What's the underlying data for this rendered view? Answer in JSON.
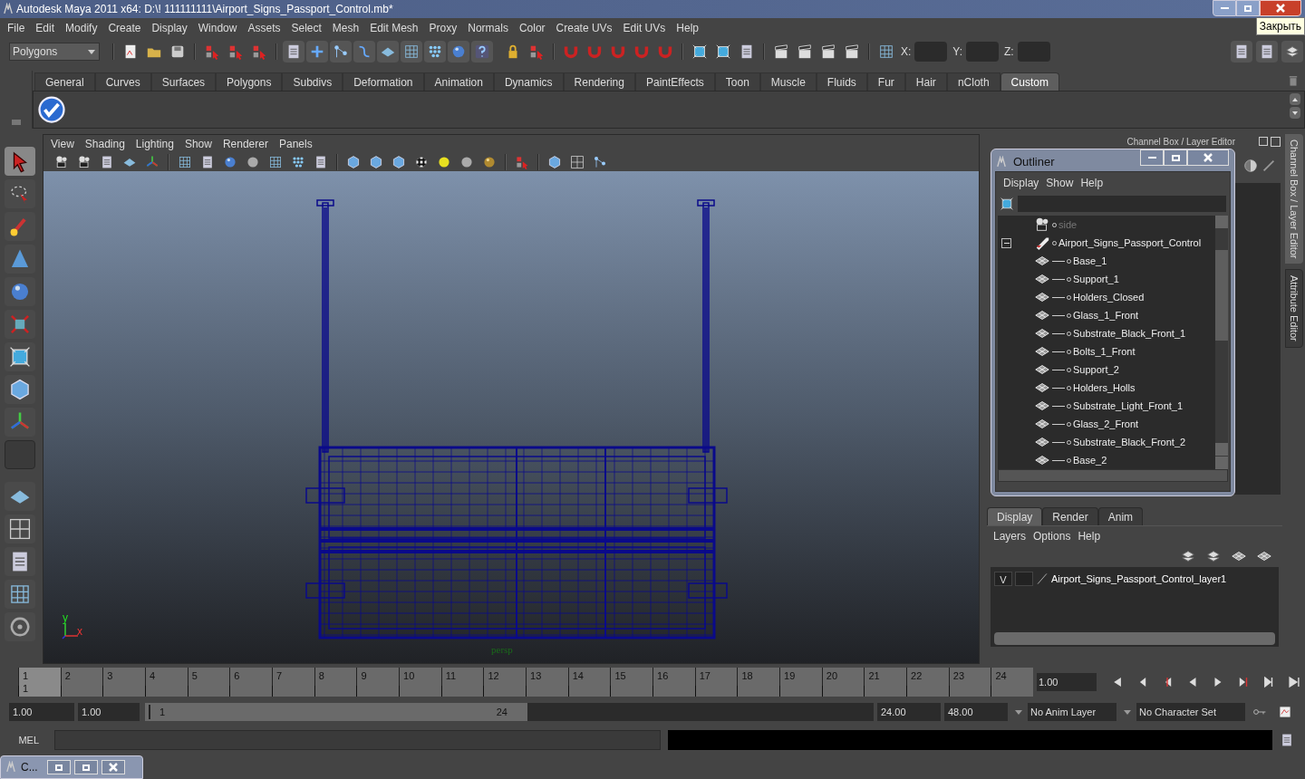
{
  "window": {
    "title": "Autodesk Maya 2011 x64: D:\\! 111111111\\Airport_Signs_Passport_Control.mb*",
    "tooltip": "Закрыть"
  },
  "menu_bar": [
    "File",
    "Edit",
    "Modify",
    "Create",
    "Display",
    "Window",
    "Assets",
    "Select",
    "Mesh",
    "Edit Mesh",
    "Proxy",
    "Normals",
    "Color",
    "Create UVs",
    "Edit UVs",
    "Help"
  ],
  "status_line": {
    "mode": "Polygons",
    "fields": [
      {
        "label": "X:"
      },
      {
        "label": "Y:"
      },
      {
        "label": "Z:"
      }
    ]
  },
  "shelf": {
    "tabs": [
      {
        "label": "General",
        "selected": false
      },
      {
        "label": "Curves",
        "selected": false
      },
      {
        "label": "Surfaces",
        "selected": false
      },
      {
        "label": "Polygons",
        "selected": false
      },
      {
        "label": "Subdivs",
        "selected": false
      },
      {
        "label": "Deformation",
        "selected": false
      },
      {
        "label": "Animation",
        "selected": false
      },
      {
        "label": "Dynamics",
        "selected": false
      },
      {
        "label": "Rendering",
        "selected": false
      },
      {
        "label": "PaintEffects",
        "selected": false
      },
      {
        "label": "Toon",
        "selected": false
      },
      {
        "label": "Muscle",
        "selected": false
      },
      {
        "label": "Fluids",
        "selected": false
      },
      {
        "label": "Fur",
        "selected": false
      },
      {
        "label": "Hair",
        "selected": false
      },
      {
        "label": "nCloth",
        "selected": false
      },
      {
        "label": "Custom",
        "selected": true
      }
    ]
  },
  "viewport": {
    "menu": [
      "View",
      "Shading",
      "Lighting",
      "Show",
      "Renderer",
      "Panels"
    ],
    "axis_y": "y",
    "axis_x": "x",
    "camera": "persp"
  },
  "channel_box": {
    "title": "Channel Box / Layer Editor"
  },
  "side_tabs": [
    {
      "label": "Channel Box / Layer Editor",
      "selected": true
    },
    {
      "label": "Attribute Editor",
      "selected": false
    }
  ],
  "outliner": {
    "title": "Outliner",
    "menu": [
      "Display",
      "Show",
      "Help"
    ],
    "items": [
      {
        "label": "side",
        "kind": "camera",
        "hidden": true
      },
      {
        "label": "Airport_Signs_Passport_Control",
        "kind": "group",
        "hidden": false,
        "expanded": true,
        "children": [
          {
            "label": "Base_1",
            "kind": "mesh",
            "hidden": false
          },
          {
            "label": "Support_1",
            "kind": "mesh",
            "hidden": false
          },
          {
            "label": "Holders_Closed",
            "kind": "mesh",
            "hidden": false
          },
          {
            "label": "Glass_1_Front",
            "kind": "mesh",
            "hidden": false
          },
          {
            "label": "Substrate_Black_Front_1",
            "kind": "mesh",
            "hidden": false
          },
          {
            "label": "Bolts_1_Front",
            "kind": "mesh",
            "hidden": false
          },
          {
            "label": "Support_2",
            "kind": "mesh",
            "hidden": false
          },
          {
            "label": "Holders_Holls",
            "kind": "mesh",
            "hidden": false
          },
          {
            "label": "Substrate_Light_Front_1",
            "kind": "mesh",
            "hidden": false
          },
          {
            "label": "Glass_2_Front",
            "kind": "mesh",
            "hidden": false
          },
          {
            "label": "Substrate_Black_Front_2",
            "kind": "mesh",
            "hidden": false
          },
          {
            "label": "Base_2",
            "kind": "mesh",
            "hidden": false
          }
        ]
      }
    ]
  },
  "layer_editor": {
    "tabs": [
      {
        "label": "Display",
        "selected": true
      },
      {
        "label": "Render",
        "selected": false
      },
      {
        "label": "Anim",
        "selected": false
      }
    ],
    "menu": [
      "Layers",
      "Options",
      "Help"
    ],
    "layers": [
      {
        "visibility": "V",
        "name": "Airport_Signs_Passport_Control_layer1"
      }
    ]
  },
  "time_slider": {
    "frames": [
      {
        "label": "1",
        "selected": true
      },
      {
        "label": "2",
        "selected": false
      },
      {
        "label": "3",
        "selected": false
      },
      {
        "label": "4",
        "selected": false
      },
      {
        "label": "5",
        "selected": false
      },
      {
        "label": "6",
        "selected": false
      },
      {
        "label": "7",
        "selected": false
      },
      {
        "label": "8",
        "selected": false
      },
      {
        "label": "9",
        "selected": false
      },
      {
        "label": "10",
        "selected": false
      },
      {
        "label": "11",
        "selected": false
      },
      {
        "label": "12",
        "selected": false
      },
      {
        "label": "13",
        "selected": false
      },
      {
        "label": "14",
        "selected": false
      },
      {
        "label": "15",
        "selected": false
      },
      {
        "label": "16",
        "selected": false
      },
      {
        "label": "17",
        "selected": false
      },
      {
        "label": "18",
        "selected": false
      },
      {
        "label": "19",
        "selected": false
      },
      {
        "label": "20",
        "selected": false
      },
      {
        "label": "21",
        "selected": false
      },
      {
        "label": "22",
        "selected": false
      },
      {
        "label": "23",
        "selected": false
      },
      {
        "label": "24",
        "selected": false
      }
    ],
    "current_frame_label": "1",
    "current_time": "1.00"
  },
  "range_slider": {
    "start": "1.00",
    "playback_start": "1.00",
    "range_start": "1",
    "range_end": "24",
    "playback_end": "24.00",
    "end": "48.00",
    "anim_layer": "No Anim Layer",
    "character_set": "No Character Set"
  },
  "command_line": {
    "label": "MEL"
  },
  "taskbar": {
    "window": "C..."
  }
}
